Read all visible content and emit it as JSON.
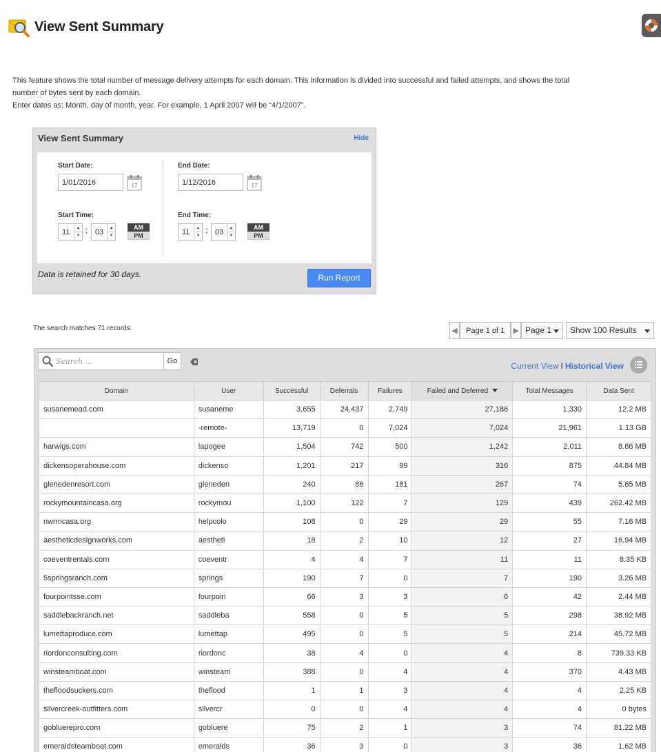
{
  "page": {
    "title": "View Sent Summary",
    "description_line1": "This feature shows the total number of message delivery attempts for each domain. This information is divided into successful and failed attempts, and shows the total",
    "description_line2": "number of bytes sent by each domain.",
    "description_line3": "Enter dates as: Month, day of month, year. For example, 1 April 2007 will be “4/1/2007”."
  },
  "filter": {
    "title": "View Sent Summary",
    "hide_label": "Hide",
    "start_date_label": "Start Date:",
    "start_date_value": "1/01/2016",
    "end_date_label": "End Date:",
    "end_date_value": "1/12/2016",
    "calendar_day": "17",
    "start_time_label": "Start Time:",
    "start_hour": "11",
    "start_minute": "03",
    "end_time_label": "End Time:",
    "end_hour": "11",
    "end_minute": "03",
    "colon": ":",
    "am_label": "AM",
    "pm_label": "PM",
    "retained_text": "Data is retained for 30 days.",
    "run_label": "Run Report"
  },
  "results": {
    "matches_text": "The search matches 71 records.",
    "page_info": "Page 1 of 1",
    "page_select": "Page 1",
    "show_select": "Show 100 Results",
    "search_placeholder": "Search ...",
    "go_label": "Go",
    "current_view": "Current View",
    "view_sep": "I",
    "historical_view": "Historical View"
  },
  "table": {
    "columns": [
      "Domain",
      "User",
      "Successful",
      "Deferrals",
      "Failures",
      "Failed and Deferred",
      "Total Messages",
      "Data Sent"
    ],
    "rows": [
      [
        "susanemead.com",
        "susaneme",
        "3,655",
        "24,437",
        "2,749",
        "27,186",
        "1,330",
        "12.2 MB"
      ],
      [
        "",
        "-remote-",
        "13,719",
        "0",
        "7,024",
        "7,024",
        "21,961",
        "1.13 GB"
      ],
      [
        "harwigs.com",
        "lapogee",
        "1,504",
        "742",
        "500",
        "1,242",
        "2,011",
        "8.86 MB"
      ],
      [
        "dickensoperahouse.com",
        "dickenso",
        "1,201",
        "217",
        "99",
        "316",
        "875",
        "44.84 MB"
      ],
      [
        "glenedenresort.com",
        "gleneden",
        "240",
        "86",
        "181",
        "267",
        "74",
        "5.65 MB"
      ],
      [
        "rockymountaincasa.org",
        "rockymou",
        "1,100",
        "122",
        "7",
        "129",
        "439",
        "262.42 MB"
      ],
      [
        "nwrmcasa.org",
        "helpcolo",
        "108",
        "0",
        "29",
        "29",
        "55",
        "7.16 MB"
      ],
      [
        "aestheticdesignworks.com",
        "aestheti",
        "18",
        "2",
        "10",
        "12",
        "27",
        "16.94 MB"
      ],
      [
        "coeventrentals.com",
        "coeventr",
        "4",
        "4",
        "7",
        "11",
        "11",
        "8.35 KB"
      ],
      [
        "5springsranch.com",
        "springs",
        "190",
        "7",
        "0",
        "7",
        "190",
        "3.26 MB"
      ],
      [
        "fourpointsse.com",
        "fourpoin",
        "66",
        "3",
        "3",
        "6",
        "42",
        "2.44 MB"
      ],
      [
        "saddlebackranch.net",
        "saddleba",
        "558",
        "0",
        "5",
        "5",
        "298",
        "38.92 MB"
      ],
      [
        "lumettaproduce.com",
        "lumettap",
        "495",
        "0",
        "5",
        "5",
        "214",
        "45.72 MB"
      ],
      [
        "riordonconsulting.com",
        "riordonc",
        "38",
        "4",
        "0",
        "4",
        "8",
        "739.33 KB"
      ],
      [
        "winsteamboat.com",
        "winsteam",
        "388",
        "0",
        "4",
        "4",
        "370",
        "4.43 MB"
      ],
      [
        "thefloodsuckers.com",
        "theflood",
        "1",
        "1",
        "3",
        "4",
        "4",
        "2.25 KB"
      ],
      [
        "silvercreek-outfitters.com",
        "silvercr",
        "0",
        "0",
        "4",
        "4",
        "4",
        "0 bytes"
      ],
      [
        "gobluerepro.com",
        "gobluere",
        "75",
        "2",
        "1",
        "3",
        "74",
        "81.22 MB"
      ],
      [
        "emeraldsteamboat.com",
        "emeralds",
        "36",
        "3",
        "0",
        "3",
        "36",
        "1.62 MB"
      ]
    ]
  },
  "colors": {
    "accent": "#4a8af4",
    "link": "#3a76d8",
    "panel_bg": "#dedede"
  },
  "icons": {
    "page": "magnifier-envelope-icon",
    "help": "lifebuoy-icon",
    "calendar": "calendar-icon",
    "search": "search-icon",
    "clear": "clear-filter-icon",
    "list": "list-icon"
  }
}
